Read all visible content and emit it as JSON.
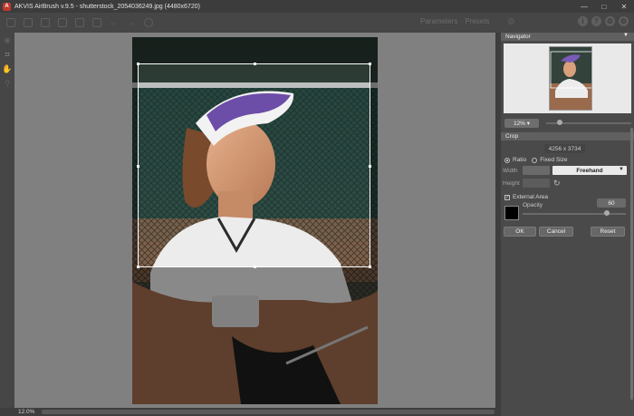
{
  "window": {
    "title": "AKVIS AirBrush v.9.5 - shutterstock_2054036249.jpg (4480x6720)",
    "logo_letter": "A",
    "minimize": "—",
    "maximize": "□",
    "close": "✕"
  },
  "toolbar": {
    "tabs": [
      "Parameters",
      "Presets"
    ],
    "help_icons": [
      "i",
      "?",
      "⚙",
      "⚙"
    ]
  },
  "navigator": {
    "title": "Navigator",
    "zoom_value": "12%",
    "zoom_level": 0.12
  },
  "crop": {
    "title": "Crop",
    "dimensions": "4256 x 3734",
    "ratio_label": "Ratio",
    "fixed_size_label": "Fixed Size",
    "width_label": "Width",
    "height_label": "Height",
    "preset_value": "Freehand",
    "external_area_label": "External Area",
    "external_area_checked": true,
    "opacity_label": "Opacity",
    "opacity_value": "60",
    "swatch_color": "#000000",
    "ok_label": "OK",
    "cancel_label": "Cancel",
    "reset_label": "Reset"
  },
  "status": {
    "zoom": "12.0%"
  }
}
